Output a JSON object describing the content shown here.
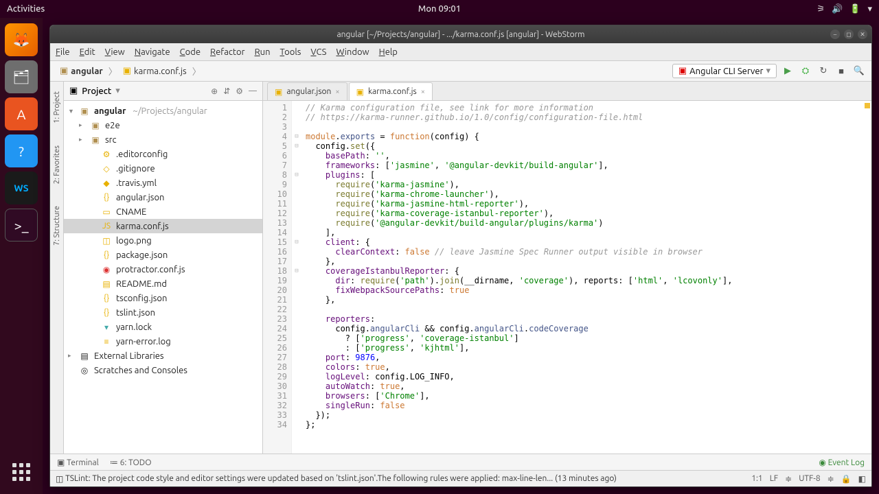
{
  "topbar": {
    "activities": "Activities",
    "clock": "Mon 09:01"
  },
  "window": {
    "title": "angular [~/Projects/angular] - .../karma.conf.js [angular] - WebStorm",
    "menus": [
      "File",
      "Edit",
      "View",
      "Navigate",
      "Code",
      "Refactor",
      "Run",
      "Tools",
      "VCS",
      "Window",
      "Help"
    ]
  },
  "breadcrumb": {
    "root": "angular",
    "file": "karma.conf.js"
  },
  "run_config": "Angular CLI Server",
  "project_panel": {
    "title": "Project"
  },
  "tree": {
    "root": "angular",
    "root_hint": "~/Projects/angular",
    "dirs": [
      "e2e",
      "src"
    ],
    "files": [
      {
        "n": ".editorconfig",
        "ic": "⚙"
      },
      {
        "n": ".gitignore",
        "ic": "◇"
      },
      {
        "n": ".travis.yml",
        "ic": "◆"
      },
      {
        "n": "angular.json",
        "ic": "{}"
      },
      {
        "n": "CNAME",
        "ic": "▭"
      },
      {
        "n": "karma.conf.js",
        "ic": "JS",
        "sel": true
      },
      {
        "n": "logo.png",
        "ic": "◫"
      },
      {
        "n": "package.json",
        "ic": "{}"
      },
      {
        "n": "protractor.conf.js",
        "ic": "◉",
        "cls": "ic-red"
      },
      {
        "n": "README.md",
        "ic": "▤"
      },
      {
        "n": "tsconfig.json",
        "ic": "{}"
      },
      {
        "n": "tslint.json",
        "ic": "{}"
      },
      {
        "n": "yarn.lock",
        "ic": "▾",
        "cls": "ic-lock"
      },
      {
        "n": "yarn-error.log",
        "ic": "≡"
      }
    ],
    "external": "External Libraries",
    "scratches": "Scratches and Consoles"
  },
  "tabs": [
    {
      "label": "angular.json",
      "active": false
    },
    {
      "label": "karma.conf.js",
      "active": true
    }
  ],
  "left_gutter": [
    "1: Project",
    "2: Favorites",
    "7: Structure"
  ],
  "code": {
    "lines": [
      [
        {
          "c": "c-com",
          "t": "// Karma configuration file, see link for more information"
        }
      ],
      [
        {
          "c": "c-com",
          "t": "// https://karma-runner.github.io/1.0/config/configuration-file.html"
        }
      ],
      [
        {
          "t": ""
        }
      ],
      [
        {
          "c": "c-kw",
          "t": "module"
        },
        {
          "t": "."
        },
        {
          "c": "c-id",
          "t": "exports"
        },
        {
          "t": " = "
        },
        {
          "c": "c-kw",
          "t": "function"
        },
        {
          "t": "(config) {"
        }
      ],
      [
        {
          "t": "  config."
        },
        {
          "c": "c-fn",
          "t": "set"
        },
        {
          "t": "({"
        }
      ],
      [
        {
          "t": "    "
        },
        {
          "c": "c-key",
          "t": "basePath"
        },
        {
          "t": ": "
        },
        {
          "c": "c-str",
          "t": "''"
        },
        {
          "t": ","
        }
      ],
      [
        {
          "t": "    "
        },
        {
          "c": "c-key",
          "t": "frameworks"
        },
        {
          "t": ": ["
        },
        {
          "c": "c-str",
          "t": "'jasmine'"
        },
        {
          "t": ", "
        },
        {
          "c": "c-str",
          "t": "'@angular-devkit/build-angular'"
        },
        {
          "t": "],"
        }
      ],
      [
        {
          "t": "    "
        },
        {
          "c": "c-key",
          "t": "plugins"
        },
        {
          "t": ": ["
        }
      ],
      [
        {
          "t": "      "
        },
        {
          "c": "c-fn",
          "t": "require"
        },
        {
          "t": "("
        },
        {
          "c": "c-str",
          "t": "'karma-jasmine'"
        },
        {
          "t": "),"
        }
      ],
      [
        {
          "t": "      "
        },
        {
          "c": "c-fn",
          "t": "require"
        },
        {
          "t": "("
        },
        {
          "c": "c-str",
          "t": "'karma-chrome-launcher'"
        },
        {
          "t": "),"
        }
      ],
      [
        {
          "t": "      "
        },
        {
          "c": "c-fn",
          "t": "require"
        },
        {
          "t": "("
        },
        {
          "c": "c-str",
          "t": "'karma-jasmine-html-reporter'"
        },
        {
          "t": "),"
        }
      ],
      [
        {
          "t": "      "
        },
        {
          "c": "c-fn",
          "t": "require"
        },
        {
          "t": "("
        },
        {
          "c": "c-str",
          "t": "'karma-coverage-istanbul-reporter'"
        },
        {
          "t": "),"
        }
      ],
      [
        {
          "t": "      "
        },
        {
          "c": "c-fn",
          "t": "require"
        },
        {
          "t": "("
        },
        {
          "c": "c-str",
          "t": "'@angular-devkit/build-angular/plugins/karma'"
        },
        {
          "t": ")"
        }
      ],
      [
        {
          "t": "    ],"
        }
      ],
      [
        {
          "t": "    "
        },
        {
          "c": "c-key",
          "t": "client"
        },
        {
          "t": ": {"
        }
      ],
      [
        {
          "t": "      "
        },
        {
          "c": "c-key",
          "t": "clearContext"
        },
        {
          "t": ": "
        },
        {
          "c": "c-kw",
          "t": "false"
        },
        {
          "t": " "
        },
        {
          "c": "c-com",
          "t": "// leave Jasmine Spec Runner output visible in browser"
        }
      ],
      [
        {
          "t": "    },"
        }
      ],
      [
        {
          "t": "    "
        },
        {
          "c": "c-key",
          "t": "coverageIstanbulReporter"
        },
        {
          "t": ": {"
        }
      ],
      [
        {
          "t": "      "
        },
        {
          "c": "c-key",
          "t": "dir"
        },
        {
          "t": ": "
        },
        {
          "c": "c-fn",
          "t": "require"
        },
        {
          "t": "("
        },
        {
          "c": "c-str",
          "t": "'path'"
        },
        {
          "t": ")."
        },
        {
          "c": "c-fn",
          "t": "join"
        },
        {
          "t": "(__dirname, "
        },
        {
          "c": "c-str",
          "t": "'coverage'"
        },
        {
          "t": "), reports: ["
        },
        {
          "c": "c-str",
          "t": "'html'"
        },
        {
          "t": ", "
        },
        {
          "c": "c-str",
          "t": "'lcovonly'"
        },
        {
          "t": "],"
        }
      ],
      [
        {
          "t": "      "
        },
        {
          "c": "c-key",
          "t": "fixWebpackSourcePaths"
        },
        {
          "t": ": "
        },
        {
          "c": "c-kw",
          "t": "true"
        }
      ],
      [
        {
          "t": "    },"
        }
      ],
      [
        {
          "t": ""
        }
      ],
      [
        {
          "t": "    "
        },
        {
          "c": "c-key",
          "t": "reporters"
        },
        {
          "t": ":"
        }
      ],
      [
        {
          "t": "      config."
        },
        {
          "c": "c-id",
          "t": "angularCli"
        },
        {
          "t": " && config."
        },
        {
          "c": "c-id",
          "t": "angularCli"
        },
        {
          "t": "."
        },
        {
          "c": "c-id",
          "t": "codeCoverage"
        }
      ],
      [
        {
          "t": "        ? ["
        },
        {
          "c": "c-str",
          "t": "'progress'"
        },
        {
          "t": ", "
        },
        {
          "c": "c-str",
          "t": "'coverage-istanbul'"
        },
        {
          "t": "]"
        }
      ],
      [
        {
          "t": "        : ["
        },
        {
          "c": "c-str",
          "t": "'progress'"
        },
        {
          "t": ", "
        },
        {
          "c": "c-str",
          "t": "'kjhtml'"
        },
        {
          "t": "],"
        }
      ],
      [
        {
          "t": "    "
        },
        {
          "c": "c-key",
          "t": "port"
        },
        {
          "t": ": "
        },
        {
          "c": "c-num",
          "t": "9876"
        },
        {
          "t": ","
        }
      ],
      [
        {
          "t": "    "
        },
        {
          "c": "c-key",
          "t": "colors"
        },
        {
          "t": ": "
        },
        {
          "c": "c-kw",
          "t": "true"
        },
        {
          "t": ","
        }
      ],
      [
        {
          "t": "    "
        },
        {
          "c": "c-key",
          "t": "logLevel"
        },
        {
          "t": ": config.LOG_INFO,"
        }
      ],
      [
        {
          "t": "    "
        },
        {
          "c": "c-key",
          "t": "autoWatch"
        },
        {
          "t": ": "
        },
        {
          "c": "c-kw",
          "t": "true"
        },
        {
          "t": ","
        }
      ],
      [
        {
          "t": "    "
        },
        {
          "c": "c-key",
          "t": "browsers"
        },
        {
          "t": ": ["
        },
        {
          "c": "c-str",
          "t": "'Chrome'"
        },
        {
          "t": "],"
        }
      ],
      [
        {
          "t": "    "
        },
        {
          "c": "c-key",
          "t": "singleRun"
        },
        {
          "t": ": "
        },
        {
          "c": "c-kw",
          "t": "false"
        }
      ],
      [
        {
          "t": "  });"
        }
      ],
      [
        {
          "t": "};"
        }
      ]
    ]
  },
  "bottom": {
    "terminal": "Terminal",
    "todo": "6: TODO",
    "eventlog": "Event Log"
  },
  "status": {
    "msg": "TSLint: The project code style and editor settings were updated based on 'tslint.json'.The following rules were applied: max-line-len... (13 minutes ago)",
    "pos": "1:1",
    "sep": "LF",
    "enc": "UTF-8"
  }
}
